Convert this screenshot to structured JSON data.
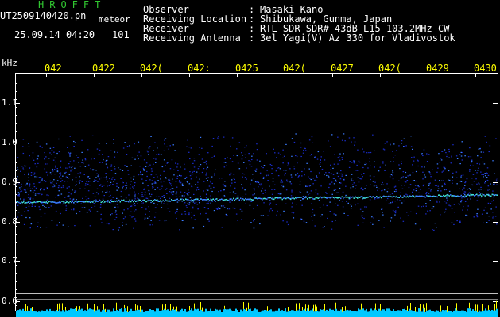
{
  "header": {
    "brand": "HROFFT",
    "filename": "UT2509140420.pn",
    "filename_suffix": "meteor",
    "date_time": "25.09.14 04:20",
    "count": "101",
    "fields": [
      {
        "label": "Observer",
        "value": "Masaki Kano"
      },
      {
        "label": "Receiving Location",
        "value": "Shibukawa, Gunma, Japan"
      },
      {
        "label": "Receiver",
        "value": "RTL-SDR SDR# 43dB L15 103.2MHz CW"
      },
      {
        "label": "Receiving Antenna",
        "value": "3el Yagi(V) Az 330 for Vladivostok"
      }
    ]
  },
  "plot": {
    "y_unit": "kHz",
    "y_ticks": [
      "1.1",
      "1.0",
      "0.9",
      "0.8",
      "0.7",
      "0.6"
    ],
    "time_ticks": [
      "042",
      "042",
      "042",
      "042",
      "042",
      "042",
      "042",
      "042",
      "042",
      "0430"
    ],
    "time_ticks_partial_glyph": [
      "",
      "2",
      "(",
      ":",
      "5",
      "(",
      "7",
      "(",
      "9",
      ""
    ],
    "colors": {
      "background": "#000000",
      "noise_dark": "#1a2cc8",
      "noise_mid": "#3a7cff",
      "signal_line": "#40e0d0",
      "axis_text": "#ffffff",
      "tick_text": "#ffff00",
      "level_bar": "#00c8ff",
      "level_peak": "#ffff00"
    }
  }
}
